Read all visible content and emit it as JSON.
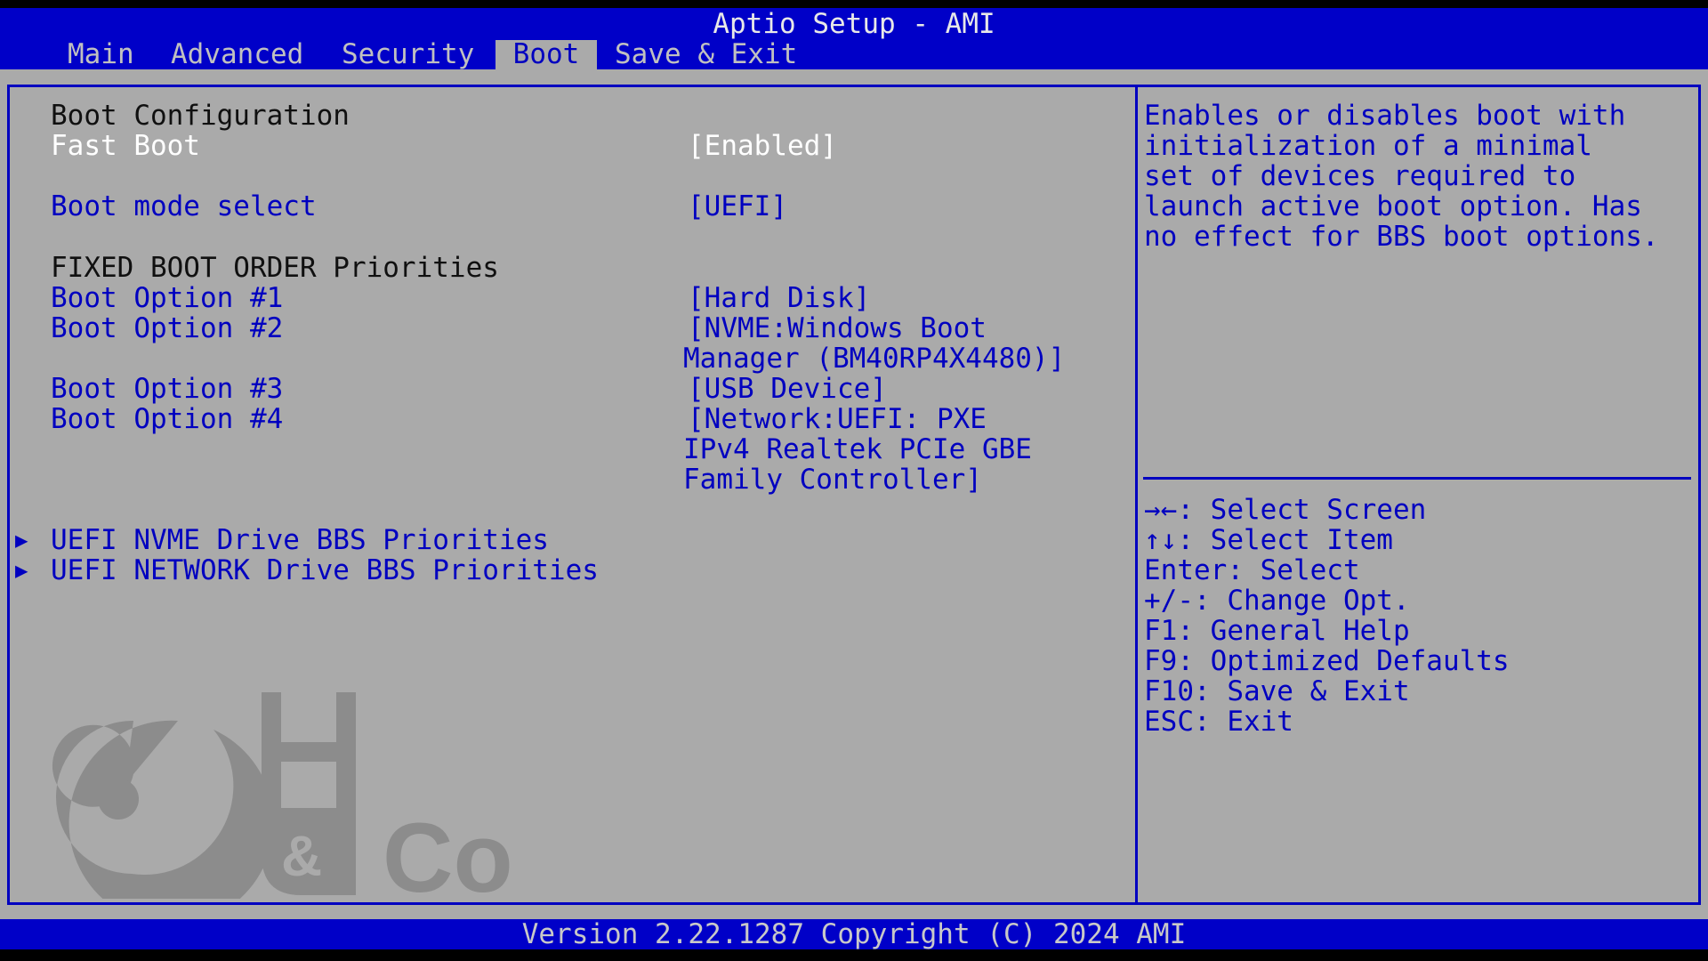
{
  "header": {
    "title": "Aptio Setup - AMI",
    "tabs": [
      {
        "label": "Main",
        "active": false
      },
      {
        "label": "Advanced",
        "active": false
      },
      {
        "label": "Security",
        "active": false
      },
      {
        "label": "Boot",
        "active": true
      },
      {
        "label": "Save & Exit",
        "active": false
      }
    ]
  },
  "main": {
    "section_boot_config": "Boot Configuration",
    "fast_boot": {
      "label": "Fast Boot",
      "value": "[Enabled]"
    },
    "boot_mode": {
      "label": "Boot mode select",
      "value": "[UEFI]"
    },
    "section_fixed_order": "FIXED BOOT ORDER Priorities",
    "boot_options": [
      {
        "label": "Boot Option #1",
        "value_lines": [
          "[Hard Disk]"
        ]
      },
      {
        "label": "Boot Option #2",
        "value_lines": [
          "[NVME:Windows Boot",
          "Manager (BM40RP4X4480)]"
        ]
      },
      {
        "label": "Boot Option #3",
        "value_lines": [
          "[USB Device]"
        ]
      },
      {
        "label": "Boot Option #4",
        "value_lines": [
          "[Network:UEFI: PXE",
          "IPv4 Realtek PCIe GBE",
          "Family Controller]"
        ]
      }
    ],
    "submenus": [
      {
        "label": "UEFI NVME Drive BBS Priorities",
        "icon": "triangle-right-icon"
      },
      {
        "label": "UEFI NETWORK Drive BBS Priorities",
        "icon": "triangle-right-icon"
      }
    ],
    "watermark_logo": "H & Co"
  },
  "help": {
    "description_lines": [
      "Enables or disables boot with",
      "initialization of a minimal",
      "set of devices required to",
      "launch active boot option. Has",
      "no effect for BBS boot options."
    ],
    "keys": [
      "→←: Select Screen",
      "↑↓: Select Item",
      "Enter: Select",
      "+/-: Change Opt.",
      "F1: General Help",
      "F9: Optimized Defaults",
      "F10: Save & Exit",
      "ESC: Exit"
    ]
  },
  "footer": {
    "version_text": "Version 2.22.1287 Copyright (C) 2024 AMI"
  },
  "colors": {
    "header_blue": "#0000c8",
    "panel_gray": "#aaaaaa",
    "selected_text": "#ffffff",
    "option_text": "#0000c0"
  }
}
